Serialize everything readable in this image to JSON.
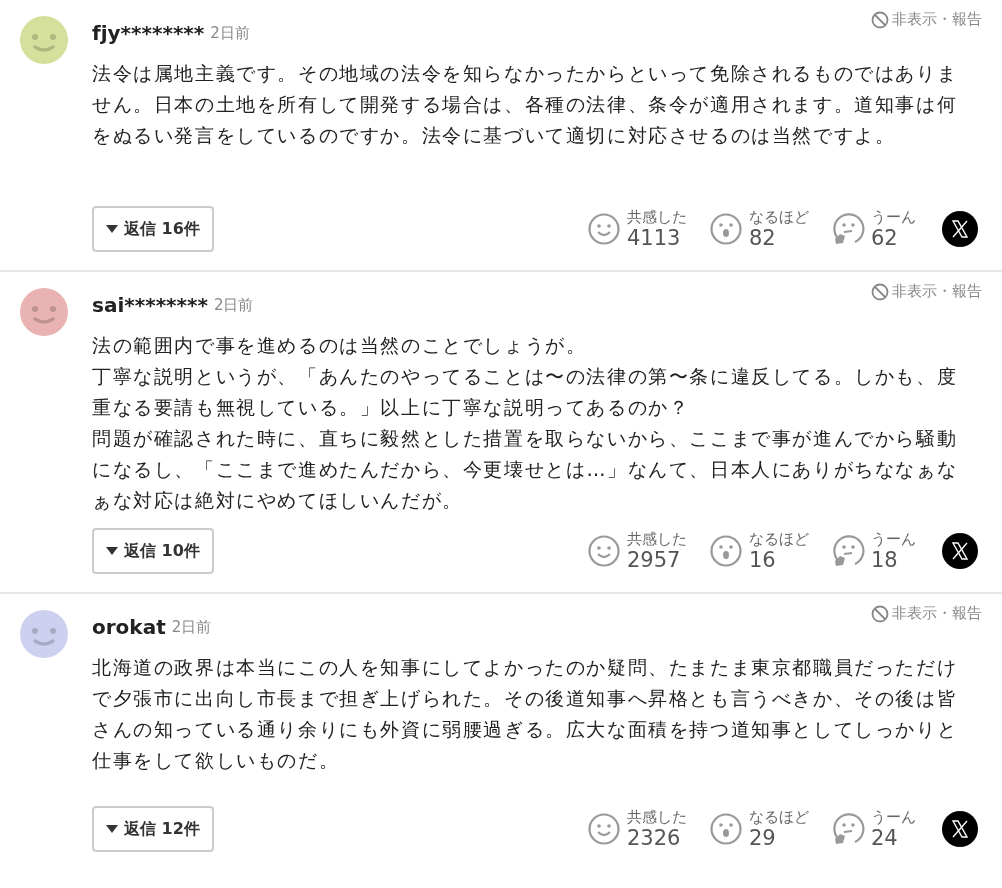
{
  "comments": [
    {
      "user": "fjy********",
      "time": "2日前",
      "color": "#d5e09c",
      "hide_label": "非表示・報告",
      "body": [
        "法令は属地主義です。その地域の法令を知らなかったからといって免除されるものではありません。日本の土地を所有して開発する場合は、各種の法律、条令が適用されます。道知事は何をぬるい発言をしているのですか。法令に基づいて適切に対応させるのは当然ですよ。"
      ],
      "replies": "返信 16件",
      "reactions": [
        {
          "kind": "smile",
          "label": "共感した",
          "count": "4113"
        },
        {
          "kind": "surprise",
          "label": "なるほど",
          "count": "82"
        },
        {
          "kind": "hmm",
          "label": "うーん",
          "count": "62"
        }
      ]
    },
    {
      "user": "sai********",
      "time": "2日前",
      "color": "#e9b3b3",
      "hide_label": "非表示・報告",
      "body": [
        "法の範囲内で事を進めるのは当然のことでしょうが。",
        "丁寧な説明というが、「あんたのやってることは〜の法律の第〜条に違反してる。しかも、度重なる要請も無視している。」以上に丁寧な説明ってあるのか？",
        "問題が確認された時に、直ちに毅然とした措置を取らないから、ここまで事が進んでから騒動になるし、「ここまで進めたんだから、今更壊せとは…」なんて、日本人にありがちななぁなぁな対応は絶対にやめてほしいんだが。"
      ],
      "replies": "返信 10件",
      "reactions": [
        {
          "kind": "smile",
          "label": "共感した",
          "count": "2957"
        },
        {
          "kind": "surprise",
          "label": "なるほど",
          "count": "16"
        },
        {
          "kind": "hmm",
          "label": "うーん",
          "count": "18"
        }
      ]
    },
    {
      "user": "orokat",
      "time": "2日前",
      "color": "#cdd0ef",
      "hide_label": "非表示・報告",
      "body": [
        "北海道の政界は本当にこの人を知事にしてよかったのか疑問、たまたま東京都職員だっただけで夕張市に出向し市長まで担ぎ上げられた。その後道知事へ昇格とも言うべきか、その後は皆さんの知っている通り余りにも外資に弱腰過ぎる。広大な面積を持つ道知事としてしっかりと仕事をして欲しいものだ。"
      ],
      "replies": "返信 12件",
      "reactions": [
        {
          "kind": "smile",
          "label": "共感した",
          "count": "2326"
        },
        {
          "kind": "surprise",
          "label": "なるほど",
          "count": "29"
        },
        {
          "kind": "hmm",
          "label": "うーん",
          "count": "24"
        }
      ]
    }
  ]
}
